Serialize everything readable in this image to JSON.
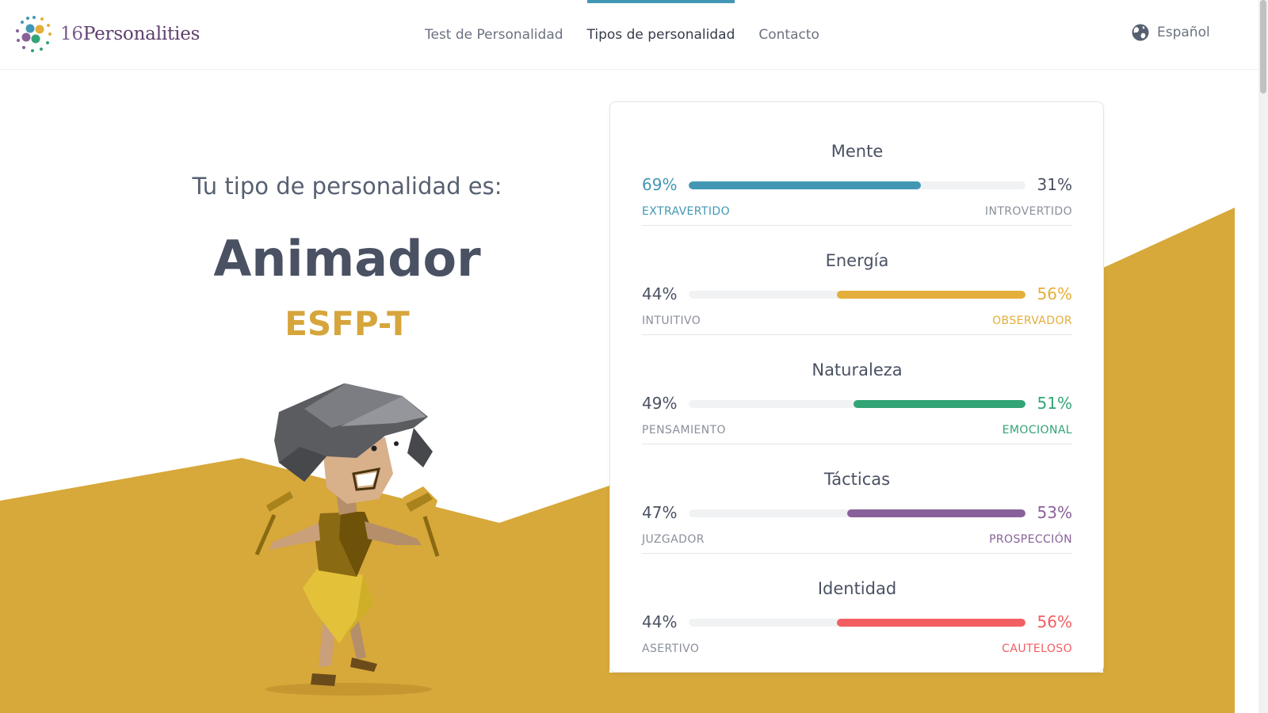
{
  "brand": {
    "number": "16",
    "name": "Personalities"
  },
  "nav": {
    "items": [
      {
        "label": "Test de Personalidad",
        "active": false
      },
      {
        "label": "Tipos de personalidad",
        "active": true
      },
      {
        "label": "Contacto",
        "active": false
      }
    ],
    "accent": "#4298b4"
  },
  "language": {
    "label": "Español",
    "icon": "globe-icon"
  },
  "hero": {
    "intro": "Tu tipo de personalidad es:",
    "type_name": "Animador",
    "type_code": "ESFP-T",
    "code_color": "#d6a53c",
    "background_color": "#d7a83a"
  },
  "traits": [
    {
      "title": "Mente",
      "left_pct": "69%",
      "right_pct": "31%",
      "left_label": "EXTRAVERTIDO",
      "right_label": "INTROVERTIDO",
      "value": 69,
      "dominant": "left",
      "color": "#4298b4"
    },
    {
      "title": "Energía",
      "left_pct": "44%",
      "right_pct": "56%",
      "left_label": "INTUITIVO",
      "right_label": "OBSERVADOR",
      "value": 56,
      "dominant": "right",
      "color": "#e4ae3a"
    },
    {
      "title": "Naturaleza",
      "left_pct": "49%",
      "right_pct": "51%",
      "left_label": "PENSAMIENTO",
      "right_label": "EMOCIONAL",
      "value": 51,
      "dominant": "right",
      "color": "#33a474"
    },
    {
      "title": "Tácticas",
      "left_pct": "47%",
      "right_pct": "53%",
      "left_label": "JUZGADOR",
      "right_label": "PROSPECCIÓN",
      "value": 53,
      "dominant": "right",
      "color": "#88619a"
    },
    {
      "title": "Identidad",
      "left_pct": "44%",
      "right_pct": "56%",
      "left_label": "ASERTIVO",
      "right_label": "CAUTELOSO",
      "value": 56,
      "dominant": "right",
      "color": "#f25e62"
    }
  ]
}
